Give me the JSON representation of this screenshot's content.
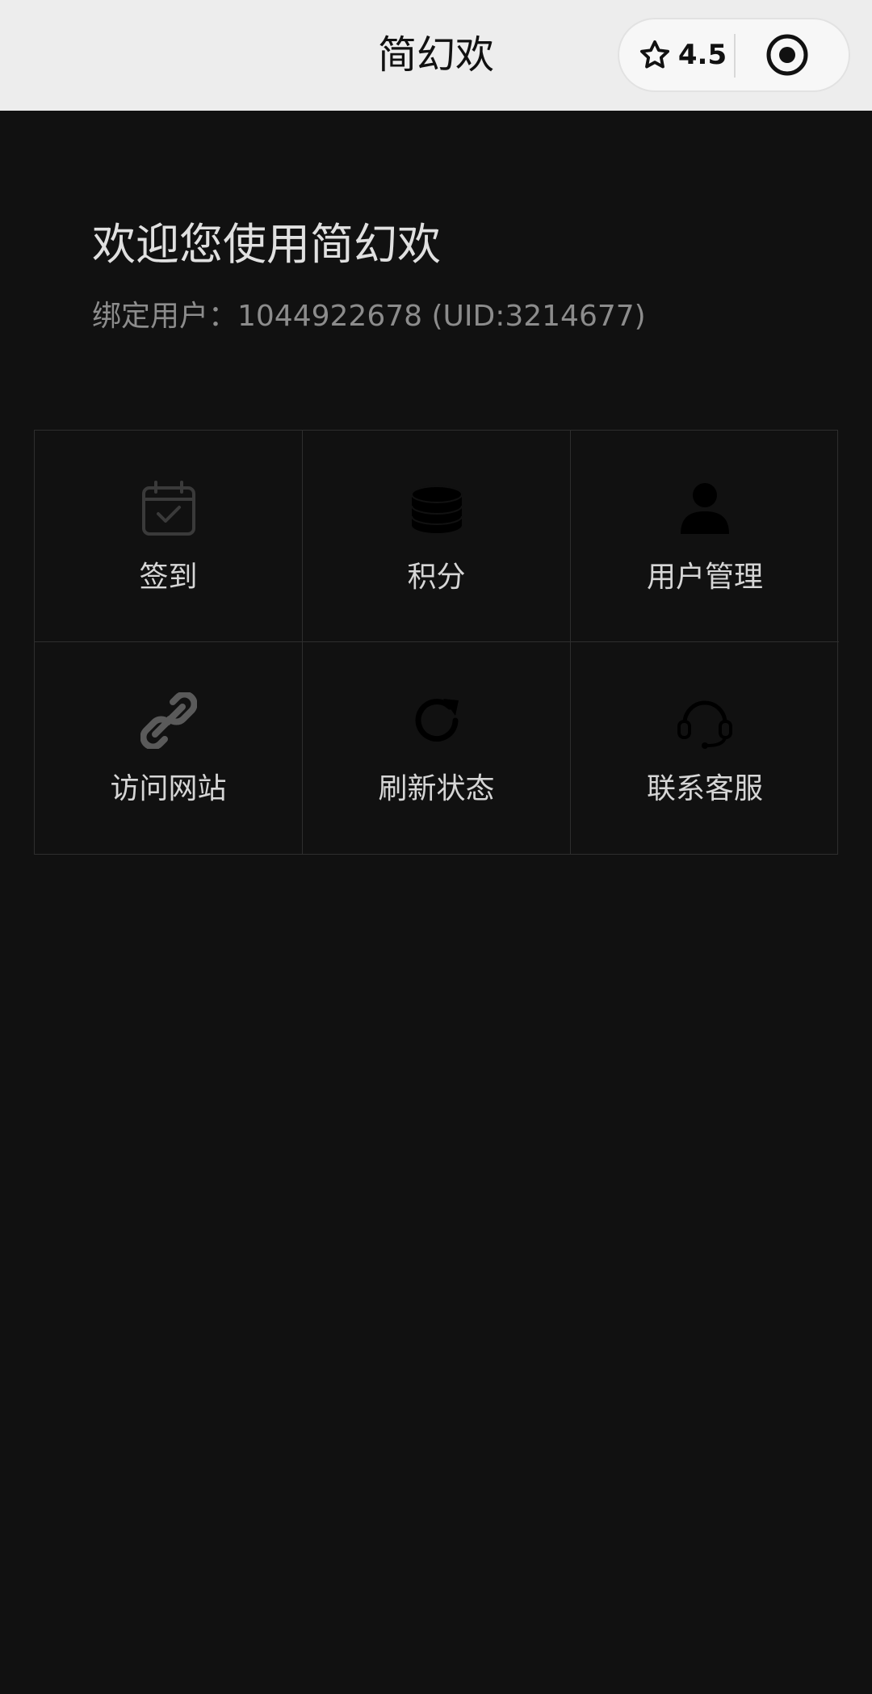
{
  "header": {
    "title": "简幻欢",
    "rating": "4.5",
    "star_icon": "star-icon",
    "close_icon": "target-circle-icon"
  },
  "welcome": {
    "title": "欢迎您使用简幻欢",
    "bound_user": "绑定用户：1044922678 (UID:3214677)"
  },
  "menu": {
    "items": [
      {
        "label": "签到",
        "icon": "calendar-check-icon"
      },
      {
        "label": "积分",
        "icon": "coins-icon"
      },
      {
        "label": "用户管理",
        "icon": "user-icon"
      },
      {
        "label": "访问网站",
        "icon": "link-icon"
      },
      {
        "label": "刷新状态",
        "icon": "refresh-icon"
      },
      {
        "label": "联系客服",
        "icon": "headset-icon"
      }
    ]
  },
  "colors": {
    "background": "#111111",
    "topbar": "#ededed",
    "grid_line": "#2e2e2e",
    "label": "#d6d6d6",
    "subtext": "#8c8c8c"
  }
}
